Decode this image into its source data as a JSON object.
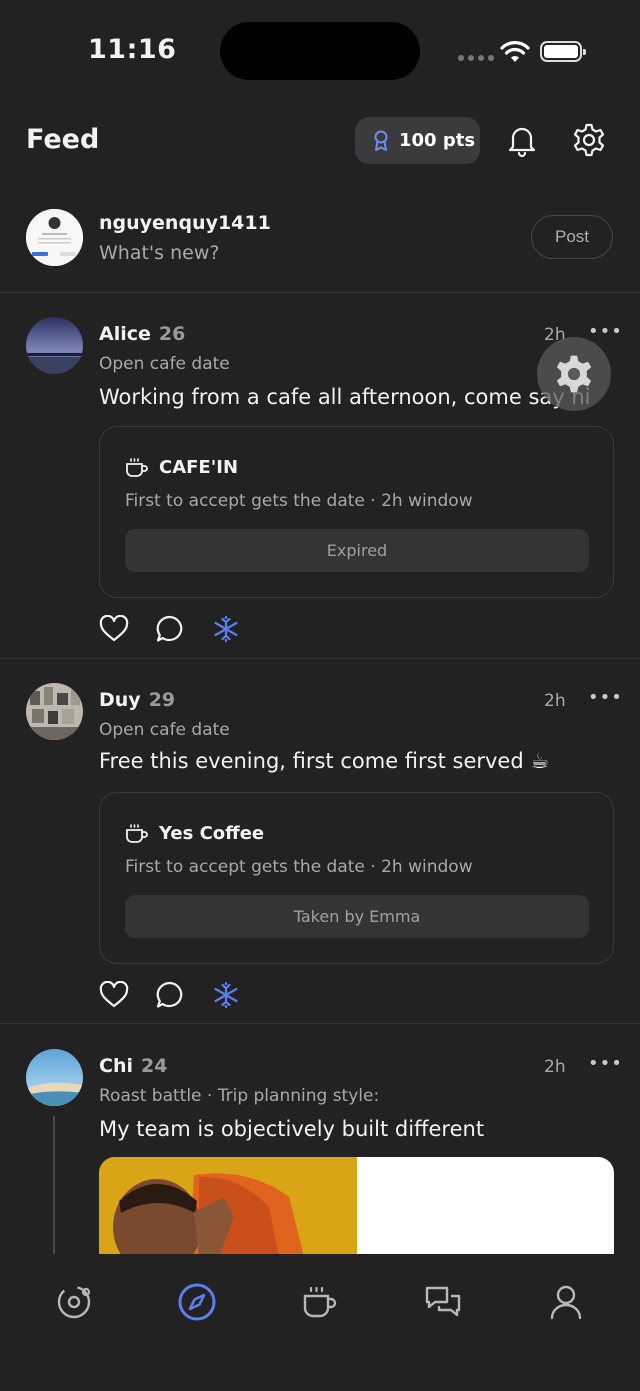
{
  "status_bar": {
    "time": "11:16"
  },
  "header": {
    "title": "Feed",
    "points": "100 pts"
  },
  "compose": {
    "username": "nguyenquy1411",
    "prompt": "What's new?",
    "post_label": "Post"
  },
  "posts": [
    {
      "name": "Alice",
      "age": "26",
      "subtitle": "Open cafe date",
      "text": "Working from a cafe all afternoon, come say hi",
      "time": "2h",
      "card": {
        "title": "CAFE'IN",
        "desc": "First to accept gets the date · 2h window",
        "status": "Expired"
      }
    },
    {
      "name": "Duy",
      "age": "29",
      "subtitle": "Open cafe date",
      "text": "Free this evening, first come first served ☕",
      "time": "2h",
      "card": {
        "title": "Yes Coffee",
        "desc": "First to accept gets the date · 2h window",
        "status": "Taken by Emma"
      }
    },
    {
      "name": "Chi",
      "age": "24",
      "subtitle": "Roast battle · Trip planning style:",
      "text": "My team is objectively built different",
      "time": "2h"
    }
  ],
  "more_glyph": "•••",
  "icons": {
    "points": "badge-icon",
    "notifications": "bell-icon",
    "settings": "gear-icon",
    "like": "heart-icon",
    "comment": "comment-icon",
    "freeze": "snowflake-icon",
    "card": "coffee-cup-icon",
    "fab": "gear-icon"
  },
  "tabs": [
    {
      "name": "orbit",
      "icon": "orbit-icon",
      "active": false
    },
    {
      "name": "discover",
      "icon": "compass-icon",
      "active": true
    },
    {
      "name": "cafe",
      "icon": "coffee-icon",
      "active": false
    },
    {
      "name": "messages",
      "icon": "chat-icon",
      "active": false
    },
    {
      "name": "profile",
      "icon": "user-icon",
      "active": false
    }
  ],
  "colors": {
    "accent": "#5b7ff0",
    "background": "#222223",
    "card_border": "#3a3a3c"
  }
}
